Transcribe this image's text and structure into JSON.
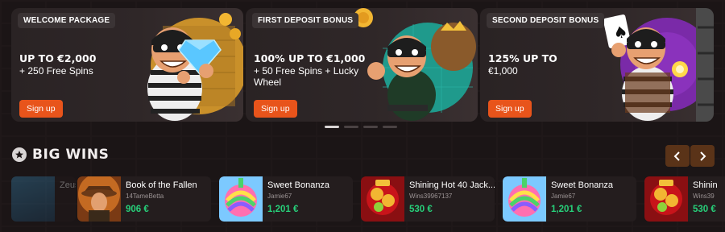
{
  "banners": [
    {
      "tag": "WELCOME PACKAGE",
      "headline": "UP TO €2,000",
      "sub": "+ 250 Free Spins",
      "cta": "Sign up"
    },
    {
      "tag": "FIRST DEPOSIT BONUS",
      "headline": "100% UP TO €1,000",
      "sub": "+ 50 Free Spins + Lucky Wheel",
      "cta": "Sign up"
    },
    {
      "tag": "SECOND DEPOSIT BONUS",
      "headline": "125% UP TO",
      "sub": "€1,000",
      "cta": "Sign up"
    }
  ],
  "carousel": {
    "slides": 4,
    "active": 1
  },
  "big_wins": {
    "title": "BIG WINS",
    "items": [
      {
        "game": "Zeus",
        "user": "",
        "amount": ""
      },
      {
        "game": "Book of the Fallen",
        "user": "14TameBetta",
        "amount": "906 €"
      },
      {
        "game": "Sweet Bonanza",
        "user": "Jamie67",
        "amount": "1,201 €"
      },
      {
        "game": "Shining Hot 40 Jack...",
        "user": "Wins39967137",
        "amount": "530 €"
      },
      {
        "game": "Sweet Bonanza",
        "user": "Jamie67",
        "amount": "1,201 €"
      },
      {
        "game": "Shinin",
        "user": "Wins39",
        "amount": "530 €"
      }
    ]
  },
  "colors": {
    "accent": "#e8541b",
    "win_amount": "#27d07a",
    "nav_button": "#5a3318"
  }
}
